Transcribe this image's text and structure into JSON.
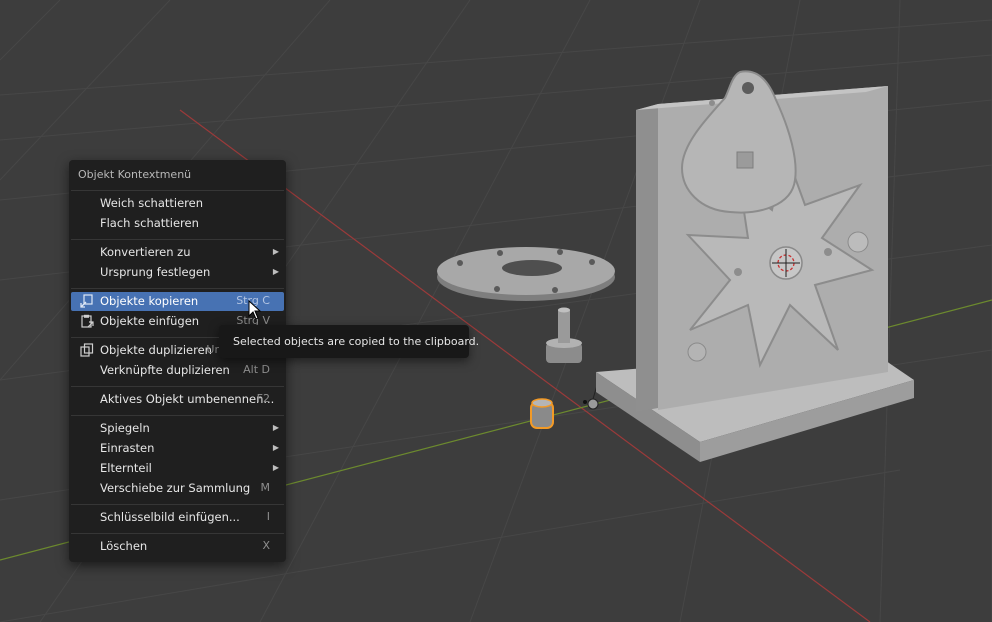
{
  "context_menu": {
    "title": "Objekt Kontextmenü",
    "items": [
      {
        "label": "Weich schattieren",
        "shortcut": "",
        "submenu": false
      },
      {
        "label": "Flach schattieren",
        "shortcut": "",
        "submenu": false
      },
      {
        "label": "Konvertieren zu",
        "shortcut": "",
        "submenu": true
      },
      {
        "label": "Ursprung festlegen",
        "shortcut": "",
        "submenu": true
      },
      {
        "label": "Objekte kopieren",
        "shortcut": "Strg C",
        "submenu": false,
        "highlighted": true,
        "icon": "copy-to-buffer-icon"
      },
      {
        "label": "Objekte einfügen",
        "shortcut": "Strg V",
        "submenu": false,
        "icon": "paste-clipboard-icon"
      },
      {
        "label": "Objekte duplizieren",
        "shortcut": "Umschalt D",
        "submenu": false,
        "icon": "duplicate-icon"
      },
      {
        "label": "Verknüpfte duplizieren",
        "shortcut": "Alt D",
        "submenu": false
      },
      {
        "label": "Aktives Objekt umbenennen...",
        "shortcut": "F2",
        "submenu": false
      },
      {
        "label": "Spiegeln",
        "shortcut": "",
        "submenu": true
      },
      {
        "label": "Einrasten",
        "shortcut": "",
        "submenu": true
      },
      {
        "label": "Elternteil",
        "shortcut": "",
        "submenu": true
      },
      {
        "label": "Verschiebe zur Sammlung",
        "shortcut": "M",
        "submenu": false
      },
      {
        "label": "Schlüsselbild einfügen...",
        "shortcut": "I",
        "submenu": false
      },
      {
        "label": "Löschen",
        "shortcut": "X",
        "submenu": false
      }
    ]
  },
  "tooltip": {
    "text": "Selected objects are copied to the clipboard."
  },
  "colors": {
    "viewport_bg": "#3d3d3d",
    "grid_line": "#4a4a4a",
    "x_axis": "#9b3a3a",
    "y_axis": "#6c8a2e",
    "menu_bg": "#1f1f1f",
    "highlight": "#4772b3",
    "selection_outline": "#f39a26",
    "model_gray": "#a3a3a3"
  }
}
